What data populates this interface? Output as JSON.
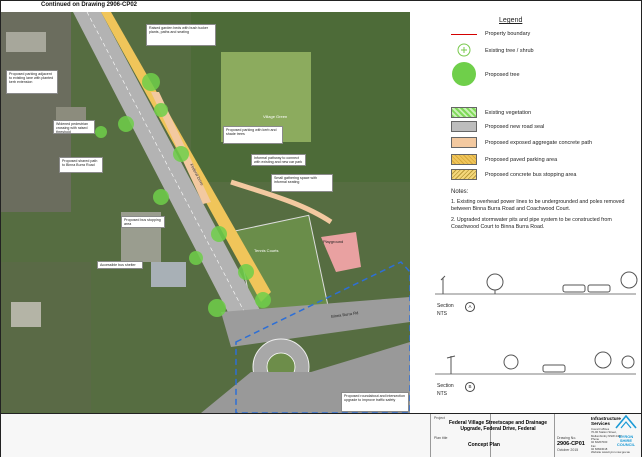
{
  "map": {
    "continued_note": "Continued on Drawing 2906-CP02",
    "labels": {
      "village_green": "Village Green",
      "tennis_courts": "Tennis Courts",
      "playground": "Playground",
      "federal_drive": "Federal Drive",
      "binna_burra_road": "Binna Burra Rd"
    }
  },
  "legend": {
    "title": "Legend",
    "items": [
      {
        "label": "Property boundary",
        "color": "#d40000"
      },
      {
        "label": "Existing tree / shrub",
        "color": "#79c94d"
      },
      {
        "label": "Proposed tree",
        "color": "#6fcf4a"
      },
      {
        "label": "Existing vegetation",
        "color": "#7ed957"
      },
      {
        "label": "Proposed new road seal",
        "color": "#bdbdbd"
      },
      {
        "label": "Proposed exposed aggregate concrete path",
        "color": "#f3c9a0"
      },
      {
        "label": "Proposed paved parking area",
        "color": "#f0c55a"
      },
      {
        "label": "Proposed concrete bus stopping area",
        "color": "#f4d77a"
      }
    ]
  },
  "notes": {
    "heading": "Notes:",
    "items": [
      "1.  Existing overhead power lines to be undergrounded and poles removed between Binna Burra Road and Coachwood Court.",
      "2.  Upgraded stormwater pits and pipe system to be constructed from Coachwood Court to Binna Burra Road."
    ]
  },
  "sections": {
    "a_label": "Section",
    "a_mark": "A",
    "b_label": "Section",
    "b_mark": "B",
    "scale": "NTS"
  },
  "title_block": {
    "project_heading": "Project",
    "project_title": "Federal Village Streetscape and Drainage Upgrade, Federal Drive, Federal",
    "plan_heading": "Plan title",
    "plan_title": "Concept Plan",
    "drawing_heading": "Drawing No.",
    "drawing_no": "2906-CP01",
    "date": "October 2015",
    "department": "Infrastructure Services",
    "contact_lines": [
      "Council offices",
      "70-90 Station Street,",
      "Mullumbimby NSW 2482",
      "Phone",
      "02 66267000",
      "Fax",
      "02 66843018",
      "Website www.byron.nsw.gov.au"
    ],
    "logo_text": "BYRON SHIRE COUNCIL"
  },
  "callouts": [
    "Proposed parking adjacent to existing lane with planted kerb extension",
    "Raised garden beds with bush tucker plants, paths and seating",
    "Widened pedestrian crossing with raised threshold",
    "Proposed parking with kerb and shade trees",
    "Informal pathway to connect with existing and new car park",
    "Proposed shared path to Binna Burra Road",
    "Small gathering space with informal seating",
    "Proposed bus stopping area",
    "Accessible bus shelter",
    "Proposed roundabout and intersection upgrade to improve traffic safety"
  ]
}
